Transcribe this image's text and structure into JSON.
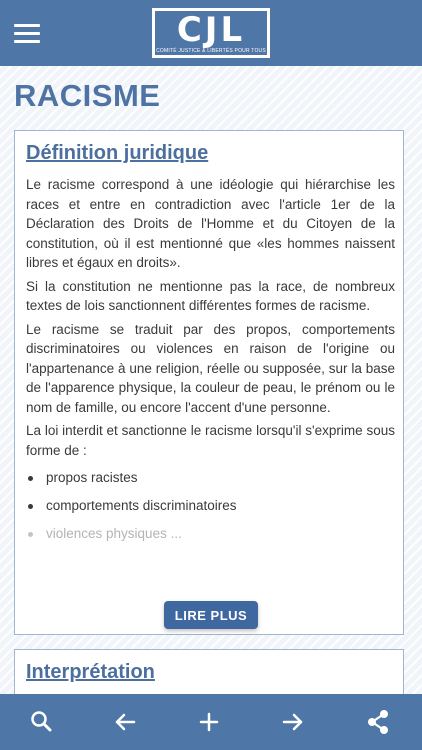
{
  "header": {
    "logo_text": "CJL",
    "logo_tagline": "COMITÉ JUSTICE & LIBERTÉS POUR TOUS"
  },
  "page": {
    "title": "RACISME"
  },
  "sections": [
    {
      "title": "Définition juridique",
      "paragraphs": [
        "Le racisme correspond à une idéologie qui hiérarchise les races et entre en contradiction avec l'article 1er de la Déclaration des Droits de l'Homme et du Citoyen de la constitution, où il est mentionné que «les hommes naissent libres et égaux en droits».",
        "Si la constitution ne mentionne pas la race, de nombreux textes de lois sanctionnent différentes formes de racisme.",
        "Le racisme se traduit par des propos, comportements discriminatoires ou violences en raison de l'origine ou l'appartenance à une religion, réelle ou supposée, sur la base de l'apparence physique, la couleur de peau, le prénom ou le nom de famille, ou encore l'accent d'une personne.",
        "La loi interdit et sanctionne le racisme lorsqu'il s'exprime sous forme de :"
      ],
      "bullets": [
        "propos racistes",
        "comportements discriminatoires",
        "violences physiques ..."
      ],
      "read_more_label": "LIRE PLUS"
    },
    {
      "title": "Interprétation"
    }
  ],
  "bottom_nav": [
    {
      "icon": "search-icon"
    },
    {
      "icon": "arrow-left-icon"
    },
    {
      "icon": "plus-icon"
    },
    {
      "icon": "arrow-right-icon"
    },
    {
      "icon": "share-icon"
    }
  ],
  "colors": {
    "bar": "#4e76a6",
    "title": "#4f74a4",
    "button": "#3f67a0"
  }
}
